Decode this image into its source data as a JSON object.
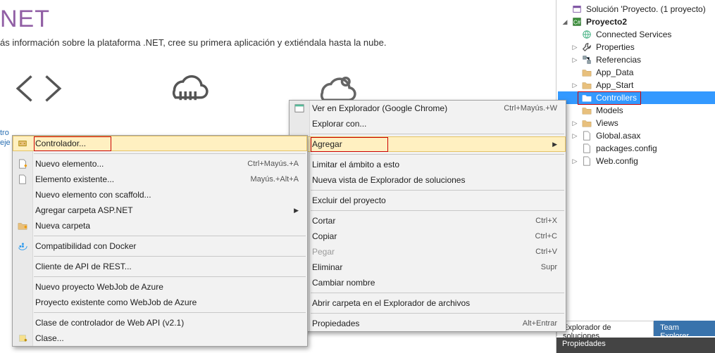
{
  "main": {
    "headline": "NET",
    "subtitle": "ás información sobre la plataforma .NET, cree su primera aplicación y extiéndala hasta la nube.",
    "cut_left": "tro\neje"
  },
  "solution": {
    "root": "Solución 'Proyecto.   (1 proyecto)",
    "project": "Proyecto2",
    "nodes": [
      {
        "label": "Connected Services",
        "icon": "globe"
      },
      {
        "label": "Properties",
        "icon": "wrench",
        "expander": "▷"
      },
      {
        "label": "Referencias",
        "icon": "refs",
        "expander": "▷"
      },
      {
        "label": "App_Data",
        "icon": "folder"
      },
      {
        "label": "App_Start",
        "icon": "folder",
        "expander": "▷"
      },
      {
        "label": "Controllers",
        "icon": "folder",
        "selected": true,
        "outline": true
      },
      {
        "label": "Models",
        "icon": "folder"
      },
      {
        "label": "Views",
        "icon": "folder",
        "expander": "▷"
      },
      {
        "label": "Global.asax",
        "icon": "file",
        "expander": "▷"
      },
      {
        "label": "packages.config",
        "icon": "file"
      },
      {
        "label": "Web.config",
        "icon": "file",
        "expander": "▷"
      }
    ],
    "tabs": {
      "explorer": "Explorador de soluciones",
      "team": "Team Explorer"
    },
    "props": "Propiedades"
  },
  "menu1": {
    "items": [
      {
        "label": "Ver en Explorador (Google Chrome)",
        "shortcut": "Ctrl+Mayús.+W",
        "icon": "browser"
      },
      {
        "label": "Explorar con..."
      },
      {
        "sep": true
      },
      {
        "label": "Agregar",
        "submenu": true,
        "hover": true,
        "outline": true
      },
      {
        "sep": true
      },
      {
        "label": "Limitar el ámbito a esto"
      },
      {
        "label": "Nueva vista de Explorador de soluciones",
        "icon": "window"
      },
      {
        "sep": true
      },
      {
        "label": "Excluir del proyecto"
      },
      {
        "sep": true
      },
      {
        "label": "Cortar",
        "shortcut": "Ctrl+X",
        "icon": "cut"
      },
      {
        "label": "Copiar",
        "shortcut": "Ctrl+C",
        "icon": "copy"
      },
      {
        "label": "Pegar",
        "shortcut": "Ctrl+V",
        "icon": "paste",
        "disabled": true
      },
      {
        "label": "Eliminar",
        "shortcut": "Supr",
        "icon": "delete"
      },
      {
        "label": "Cambiar nombre",
        "icon": "rename"
      },
      {
        "sep": true
      },
      {
        "label": "Abrir carpeta en el Explorador de archivos",
        "icon": "openfolder"
      },
      {
        "sep": true
      },
      {
        "label": "Propiedades",
        "shortcut": "Alt+Entrar",
        "icon": "wrench"
      }
    ]
  },
  "menu2": {
    "items": [
      {
        "label": "Controlador...",
        "icon": "controller",
        "hover": true,
        "outline": true
      },
      {
        "sep": true
      },
      {
        "label": "Nuevo elemento...",
        "shortcut": "Ctrl+Mayús.+A",
        "icon": "newitem"
      },
      {
        "label": "Elemento existente...",
        "shortcut": "Mayús.+Alt+A",
        "icon": "existitem"
      },
      {
        "label": "Nuevo elemento con scaffold..."
      },
      {
        "label": "Agregar carpeta ASP.NET",
        "submenu": true
      },
      {
        "label": "Nueva carpeta",
        "icon": "newfolder"
      },
      {
        "sep": true
      },
      {
        "label": "Compatibilidad con Docker",
        "icon": "docker"
      },
      {
        "sep": true
      },
      {
        "label": "Cliente de API de REST..."
      },
      {
        "sep": true
      },
      {
        "label": "Nuevo proyecto WebJob de Azure"
      },
      {
        "label": "Proyecto existente como WebJob de Azure"
      },
      {
        "sep": true
      },
      {
        "label": "Clase de controlador de Web API (v2.1)"
      },
      {
        "label": "Clase...",
        "icon": "class"
      }
    ]
  }
}
